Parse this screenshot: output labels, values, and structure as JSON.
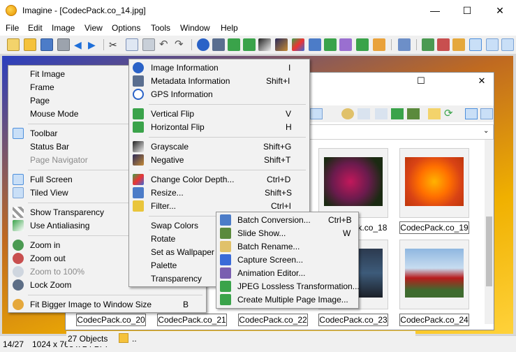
{
  "window": {
    "title": "Imagine - [CodecPack.co_14.jpg]",
    "controls": {
      "minimize": "—",
      "maximize": "☐",
      "close": "✕"
    }
  },
  "menubar": [
    "File",
    "Edit",
    "Image",
    "View",
    "Options",
    "Tools",
    "Window",
    "Help"
  ],
  "browser": {
    "controls": {
      "maximize": "☐",
      "close": "✕"
    },
    "path": "...",
    "thumbnails": [
      {
        "caption": "CodecPack.co_18"
      },
      {
        "caption": "CodecPack.co_19"
      },
      {
        "caption": "CodecPack.co_20"
      },
      {
        "caption": "CodecPack.co_21"
      },
      {
        "caption": "CodecPack.co_22"
      },
      {
        "caption": "CodecPack.co_23"
      },
      {
        "caption": "CodecPack.co_24"
      }
    ],
    "objects_text": "27 Objects",
    "folder_text": ".."
  },
  "statusbar": {
    "position": "14/27",
    "dimensions": "1024 x 768 x 24 BPP"
  },
  "view_menu": {
    "items": [
      {
        "label": "Fit Image",
        "icon": "none",
        "disabled": false
      },
      {
        "label": "Frame",
        "icon": "none",
        "disabled": false
      },
      {
        "label": "Page",
        "icon": "none",
        "disabled": false
      },
      {
        "label": "Mouse Mode",
        "icon": "none",
        "disabled": false
      },
      {
        "label": "Toolbar",
        "icon": "toolbar-icon",
        "disabled": false
      },
      {
        "label": "Status Bar",
        "icon": "none",
        "disabled": false
      },
      {
        "label": "Page Navigator",
        "icon": "none",
        "disabled": true
      },
      {
        "label": "Full Screen",
        "icon": "fullscreen-icon",
        "disabled": false
      },
      {
        "label": "Tiled View",
        "icon": "tiled-view-icon",
        "disabled": false
      },
      {
        "label": "Show Transparency",
        "icon": "transparency-icon",
        "disabled": false
      },
      {
        "label": "Use Antialiasing",
        "icon": "antialias-icon",
        "disabled": false
      },
      {
        "label": "Zoom in",
        "icon": "zoom-in-icon",
        "disabled": false
      },
      {
        "label": "Zoom out",
        "icon": "zoom-out-icon",
        "disabled": false
      },
      {
        "label": "Zoom to 100%",
        "icon": "zoom-100-icon",
        "disabled": true
      },
      {
        "label": "Lock Zoom",
        "icon": "lock-zoom-icon",
        "disabled": false
      },
      {
        "label": "Fit Bigger Image to Window Size",
        "icon": "fit-window-icon",
        "shortcut": "B",
        "disabled": false
      }
    ]
  },
  "image_menu": {
    "items": [
      {
        "label": "Image Information",
        "shortcut": "I",
        "icon": "info-icon"
      },
      {
        "label": "Metadata Information",
        "shortcut": "Shift+I",
        "icon": "metadata-icon"
      },
      {
        "label": "GPS Information",
        "shortcut": "",
        "icon": "gps-icon"
      },
      {
        "label": "Vertical Flip",
        "shortcut": "V",
        "icon": "vertical-flip-icon"
      },
      {
        "label": "Horizontal Flip",
        "shortcut": "H",
        "icon": "horizontal-flip-icon"
      },
      {
        "label": "Grayscale",
        "shortcut": "Shift+G",
        "icon": "grayscale-icon"
      },
      {
        "label": "Negative",
        "shortcut": "Shift+T",
        "icon": "negative-icon"
      },
      {
        "label": "Change Color Depth...",
        "shortcut": "Ctrl+D",
        "icon": "color-depth-icon"
      },
      {
        "label": "Resize...",
        "shortcut": "Shift+S",
        "icon": "resize-icon"
      },
      {
        "label": "Filter...",
        "shortcut": "Ctrl+I",
        "icon": "filter-icon"
      },
      {
        "label": "Swap Colors",
        "shortcut": "",
        "icon": "none"
      },
      {
        "label": "Rotate",
        "shortcut": "",
        "icon": "none"
      },
      {
        "label": "Set as Wallpaper",
        "shortcut": "",
        "icon": "none"
      },
      {
        "label": "Palette",
        "shortcut": "",
        "icon": "none"
      },
      {
        "label": "Transparency",
        "shortcut": "",
        "icon": "none"
      }
    ]
  },
  "tools_menu": {
    "items": [
      {
        "label": "Batch Conversion...",
        "shortcut": "Ctrl+B",
        "icon": "batch-conversion-icon"
      },
      {
        "label": "Slide Show...",
        "shortcut": "W",
        "icon": "slideshow-icon"
      },
      {
        "label": "Batch Rename...",
        "shortcut": "",
        "icon": "batch-rename-icon"
      },
      {
        "label": "Capture Screen...",
        "shortcut": "",
        "icon": "capture-screen-icon"
      },
      {
        "label": "Animation Editor...",
        "shortcut": "",
        "icon": "animation-editor-icon"
      },
      {
        "label": "JPEG Lossless Transformation...",
        "shortcut": "",
        "icon": "jpeg-icon"
      },
      {
        "label": "Create Multiple Page Image...",
        "shortcut": "",
        "icon": "multipage-icon"
      }
    ]
  },
  "colors": {
    "highlight": "#91c9f7",
    "menu_bg": "#f2f2f2",
    "toolbar_bg": "#f0f0f0"
  }
}
